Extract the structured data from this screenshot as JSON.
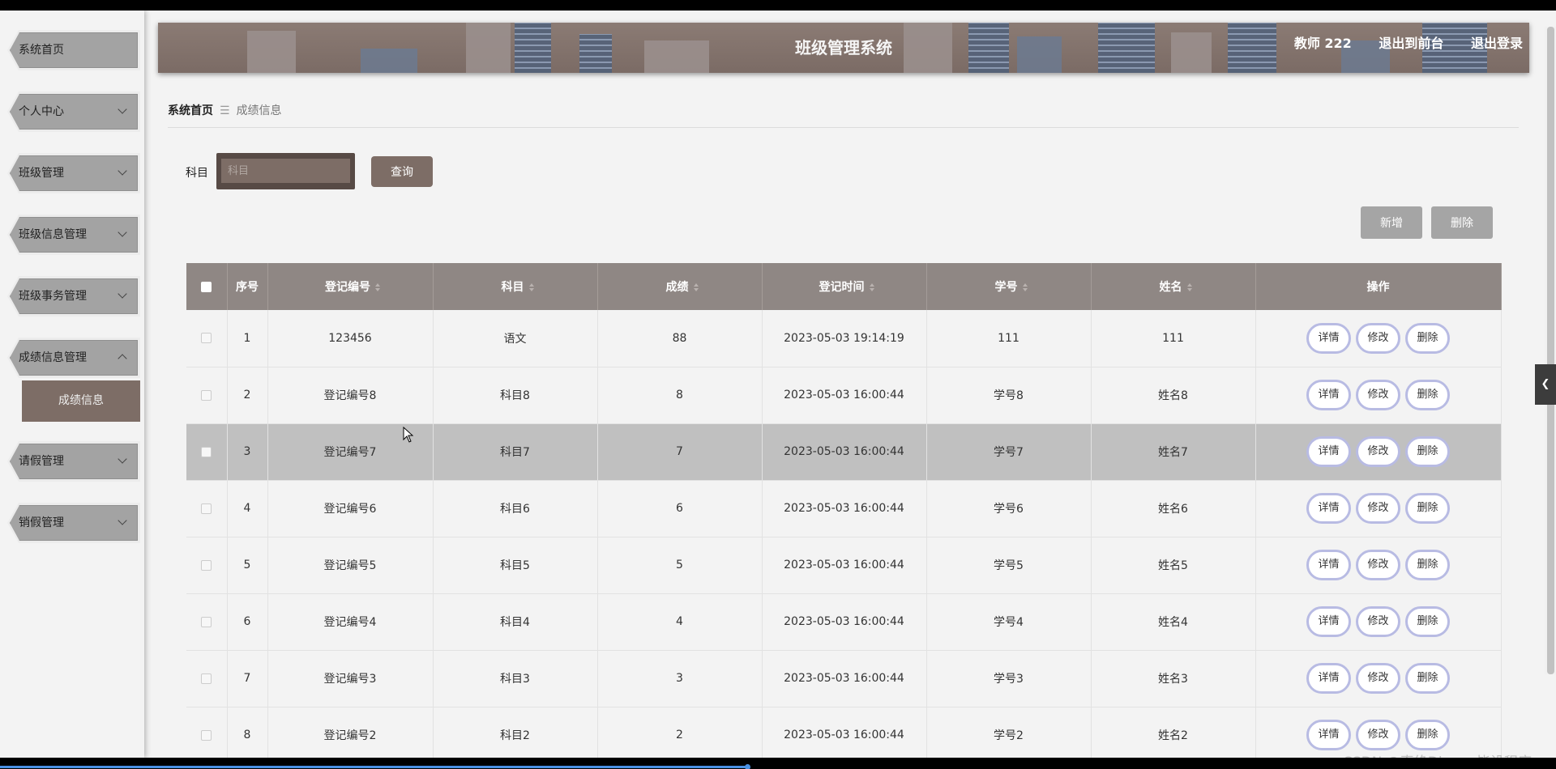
{
  "sidebar": {
    "items": [
      {
        "label": "系统首页",
        "has_chevron": false
      },
      {
        "label": "个人中心",
        "has_chevron": true
      },
      {
        "label": "班级管理",
        "has_chevron": true
      },
      {
        "label": "班级信息管理",
        "has_chevron": true
      },
      {
        "label": "班级事务管理",
        "has_chevron": true
      },
      {
        "label": "成绩信息管理",
        "has_chevron": true,
        "expanded": true
      },
      {
        "label": "请假管理",
        "has_chevron": true
      },
      {
        "label": "销假管理",
        "has_chevron": true
      }
    ],
    "sub_item": "成绩信息"
  },
  "header": {
    "title": "班级管理系统",
    "user": "教师 222",
    "to_front": "退出到前台",
    "logout": "退出登录"
  },
  "breadcrumb": {
    "home": "系统首页",
    "separator": "☰",
    "current": "成绩信息"
  },
  "search": {
    "label": "科目",
    "placeholder": "科目",
    "value": "",
    "button": "查询"
  },
  "actions": {
    "add": "新增",
    "delete": "删除"
  },
  "table": {
    "columns": [
      "序号",
      "登记编号",
      "科目",
      "成绩",
      "登记时间",
      "学号",
      "姓名",
      "操作"
    ],
    "op_labels": {
      "detail": "详情",
      "edit": "修改",
      "delete": "删除"
    },
    "rows": [
      {
        "no": "1",
        "reg_no": "123456",
        "subject": "语文",
        "score": "88",
        "time": "2023-05-03 19:14:19",
        "student_id": "111",
        "name": "111"
      },
      {
        "no": "2",
        "reg_no": "登记编号8",
        "subject": "科目8",
        "score": "8",
        "time": "2023-05-03 16:00:44",
        "student_id": "学号8",
        "name": "姓名8"
      },
      {
        "no": "3",
        "reg_no": "登记编号7",
        "subject": "科目7",
        "score": "7",
        "time": "2023-05-03 16:00:44",
        "student_id": "学号7",
        "name": "姓名7",
        "highlighted": true
      },
      {
        "no": "4",
        "reg_no": "登记编号6",
        "subject": "科目6",
        "score": "6",
        "time": "2023-05-03 16:00:44",
        "student_id": "学号6",
        "name": "姓名6"
      },
      {
        "no": "5",
        "reg_no": "登记编号5",
        "subject": "科目5",
        "score": "5",
        "time": "2023-05-03 16:00:44",
        "student_id": "学号5",
        "name": "姓名5"
      },
      {
        "no": "6",
        "reg_no": "登记编号4",
        "subject": "科目4",
        "score": "4",
        "time": "2023-05-03 16:00:44",
        "student_id": "学号4",
        "name": "姓名4"
      },
      {
        "no": "7",
        "reg_no": "登记编号3",
        "subject": "科目3",
        "score": "3",
        "time": "2023-05-03 16:00:44",
        "student_id": "学号3",
        "name": "姓名3"
      },
      {
        "no": "8",
        "reg_no": "登记编号2",
        "subject": "科目2",
        "score": "2",
        "time": "2023-05-03 16:00:44",
        "student_id": "学号2",
        "name": "姓名2"
      }
    ]
  },
  "watermark": "CSDN @真绝Django毕设程序",
  "icons": {
    "collapse": "chevron-left-icon",
    "sort": "sort-icon",
    "cursor": "mouse-pointer-icon"
  },
  "colors": {
    "accent": "#7d6d66",
    "header_row": "#8f8784",
    "op_border": "#b8bbe3",
    "highlight_row": "#c0c0c0"
  }
}
